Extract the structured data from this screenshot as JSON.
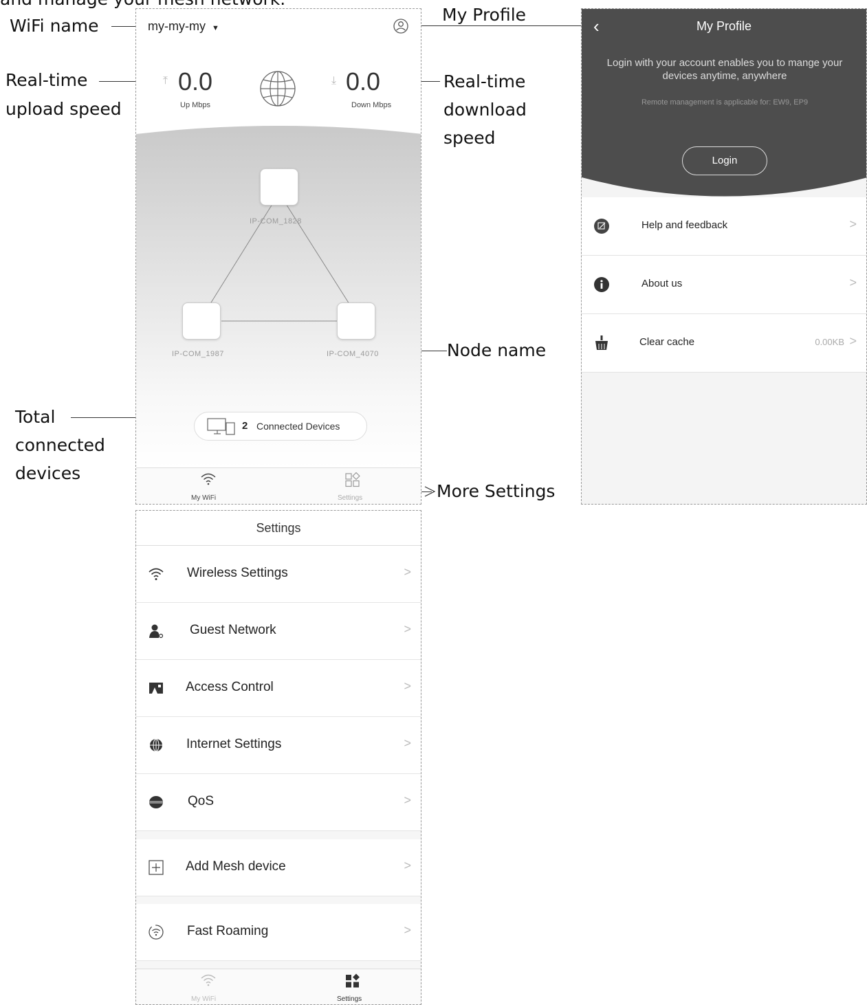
{
  "annotations": {
    "top_caption": "and manage your mesh network.",
    "wifi_name": "WiFi name",
    "my_profile": "My Profile",
    "upload_line1": "Real-time",
    "upload_line2": "upload speed",
    "download_line1": "Real-time",
    "download_line2": "download",
    "download_line3": "speed",
    "node_name": "Node name",
    "total_line1": "Total",
    "total_line2": "connected",
    "total_line3": "devices",
    "more_settings": "More Settings"
  },
  "main": {
    "wifi_name": "my-my-my",
    "up_speed": "0.0",
    "up_unit": "Up Mbps",
    "down_speed": "0.0",
    "down_unit": "Down Mbps",
    "nodes": [
      "IP-COM_1828",
      "IP-COM_1987",
      "IP-COM_4070"
    ],
    "device_count": "2",
    "devices_label": "Connected Devices",
    "tabs": {
      "wifi": "My WiFi",
      "settings": "Settings"
    }
  },
  "settings": {
    "title": "Settings",
    "items": [
      {
        "label": "Wireless Settings",
        "icon": "wifi-icon"
      },
      {
        "label": "Guest Network",
        "icon": "guest-icon"
      },
      {
        "label": "Access Control",
        "icon": "access-control-icon"
      },
      {
        "label": "Internet Settings",
        "icon": "globe-icon"
      },
      {
        "label": "QoS",
        "icon": "qos-icon"
      },
      {
        "label": "Add Mesh device",
        "icon": "add-icon"
      },
      {
        "label": "Fast Roaming",
        "icon": "roaming-icon"
      }
    ],
    "tabs": {
      "wifi": "My WiFi",
      "settings": "Settings"
    }
  },
  "profile": {
    "title": "My Profile",
    "login_message": "Login with your account enables you to mange your devices anytime, anywhere",
    "remote_note": "Remote management is applicable for: EW9, EP9",
    "login_button": "Login",
    "items": [
      {
        "label": "Help and feedback",
        "icon": "feedback-icon"
      },
      {
        "label": "About us",
        "icon": "info-icon"
      },
      {
        "label": "Clear cache",
        "icon": "broom-icon",
        "value": "0.00KB"
      }
    ]
  },
  "colors": {
    "profile_header": "#4d4d4d",
    "chevron": "#bbbbbb",
    "annotation_line": "#333333"
  }
}
